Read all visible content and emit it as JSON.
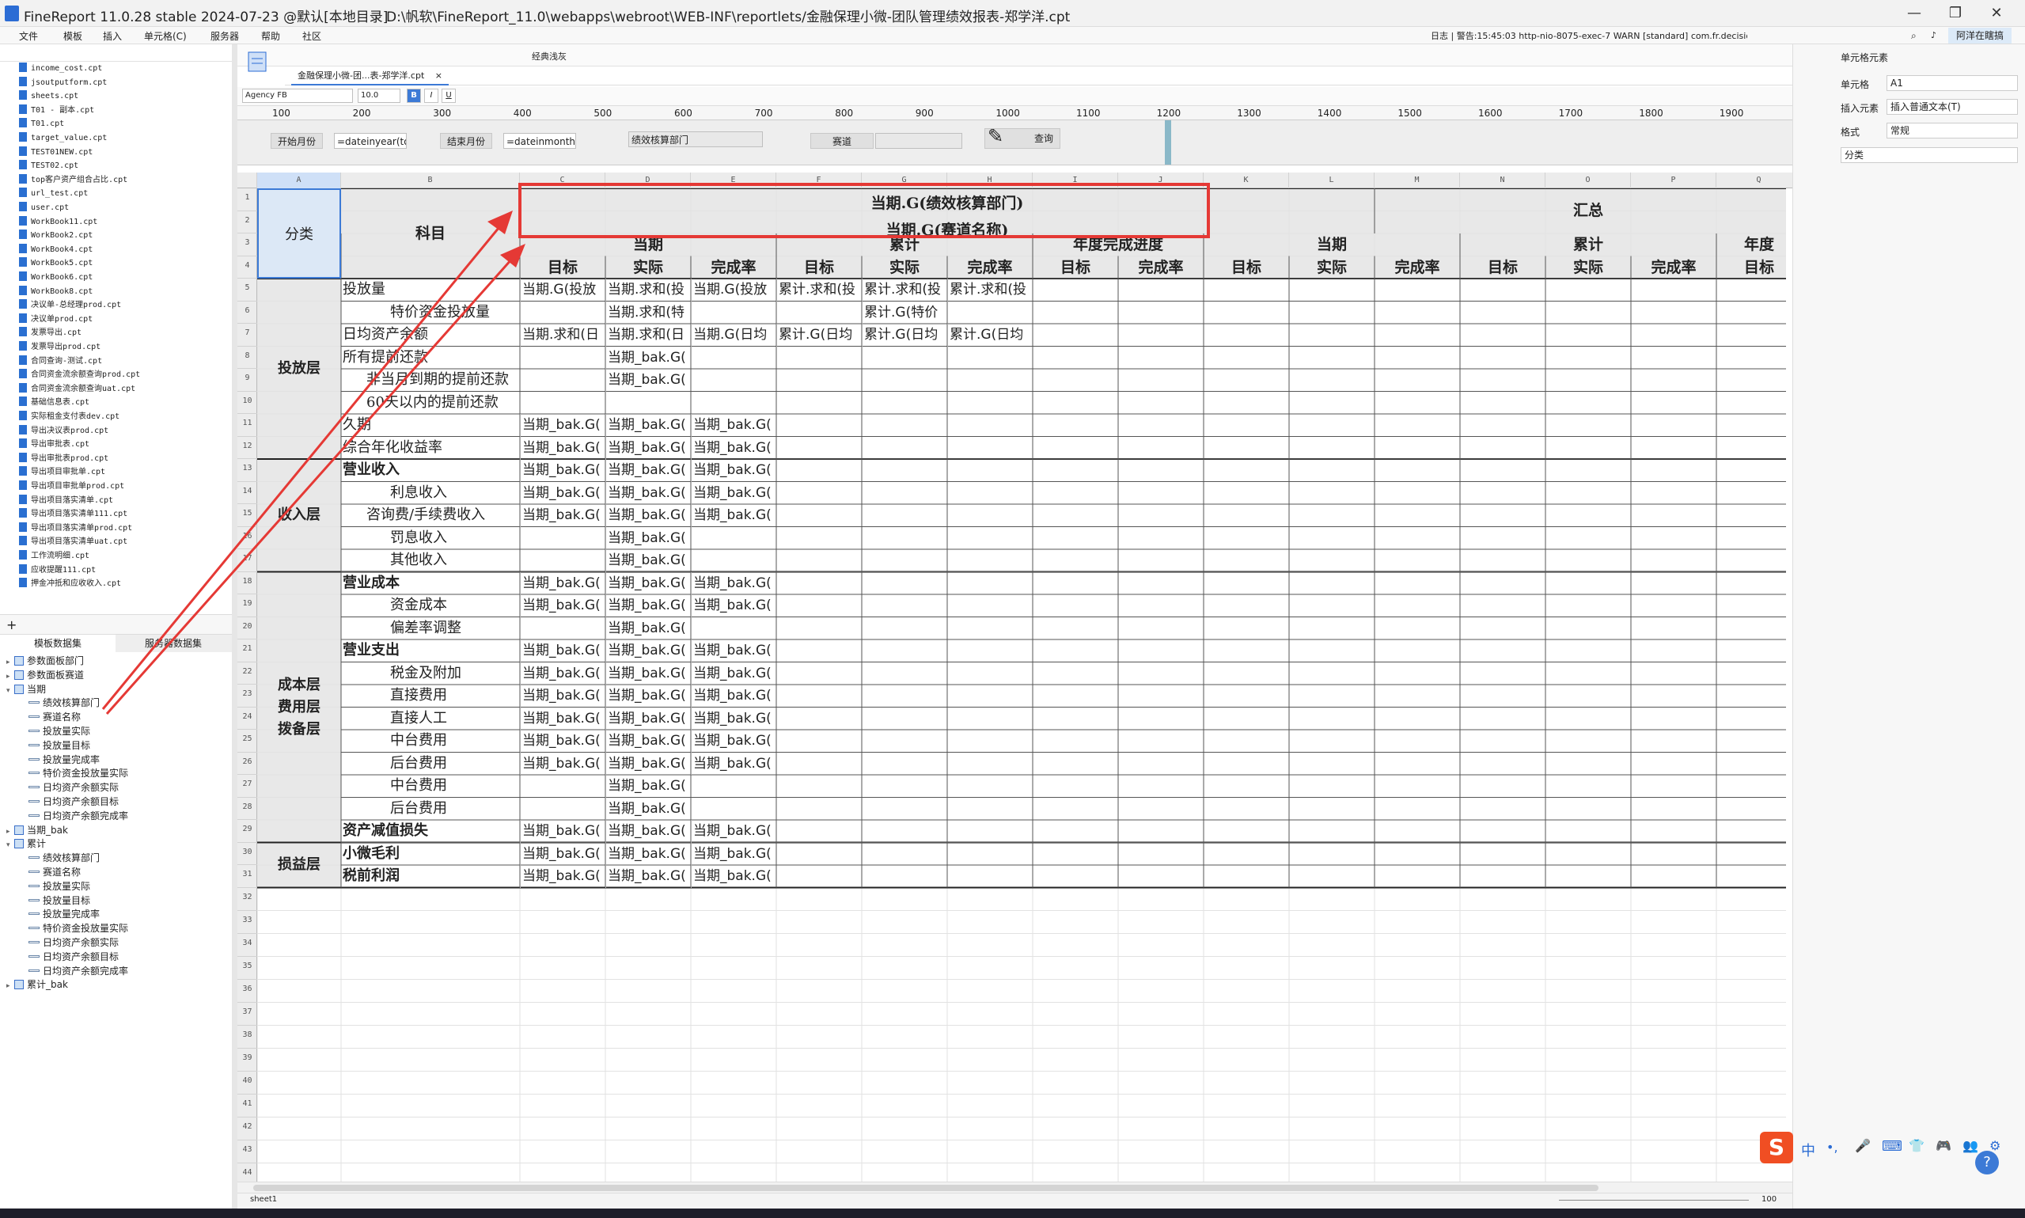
{
  "window": {
    "title": "FineReport 11.0.28 stable 2024-07-23 @默认[本地目录]",
    "path": "D:\\帆软\\FineReport_11.0\\webapps\\webroot\\WEB-INF\\reportlets/金融保理小微-团队管理绩效报表-郑学洋.cpt",
    "min": "—",
    "max": "❐",
    "close": "✕"
  },
  "menu": [
    "文件",
    "模板",
    "插入",
    "单元格(C)",
    "服务器",
    "帮助",
    "社区"
  ],
  "log": "日志 | 警告:15:45:03 http-nio-8075-exec-7 WARN [standard] com.fr.decision.webservice.exception.lo...",
  "user": "阿洋在瞎搞",
  "files": [
    "income_cost.cpt",
    "jsoutputform.cpt",
    "sheets.cpt",
    "T01 - 副本.cpt",
    "T01.cpt",
    "target_value.cpt",
    "TEST01NEW.cpt",
    "TEST02.cpt",
    "top客户资产组合占比.cpt",
    "url_test.cpt",
    "user.cpt",
    "WorkBook11.cpt",
    "WorkBook2.cpt",
    "WorkBook4.cpt",
    "WorkBook5.cpt",
    "WorkBook6.cpt",
    "WorkBook8.cpt",
    "决议单-总经理prod.cpt",
    "决议单prod.cpt",
    "发票导出.cpt",
    "发票导出prod.cpt",
    "合同查询-测试.cpt",
    "合同资金流余额查询prod.cpt",
    "合同资金流余额查询uat.cpt",
    "基础信息表.cpt",
    "实际租金支付表dev.cpt",
    "导出决议表prod.cpt",
    "导出审批表.cpt",
    "导出审批表prod.cpt",
    "导出项目审批单.cpt",
    "导出项目审批单prod.cpt",
    "导出项目落实清单.cpt",
    "导出项目落实清单111.cpt",
    "导出项目落实清单prod.cpt",
    "导出项目落实清单uat.cpt",
    "工作流明细.cpt",
    "应收提醒111.cpt",
    "押金冲抵和应收收入.cpt"
  ],
  "left_tabs": [
    "模板数据集",
    "服务器数据集"
  ],
  "ds_tree": [
    {
      "t": "tbl",
      "label": "参数面板部门",
      "lv": 0,
      "arw": "▸"
    },
    {
      "t": "tbl",
      "label": "参数面板赛道",
      "lv": 0,
      "arw": "▸"
    },
    {
      "t": "tbl",
      "label": "当期",
      "lv": 0,
      "arw": "▾"
    },
    {
      "t": "fld",
      "label": "绩效核算部门",
      "lv": 1
    },
    {
      "t": "fld",
      "label": "赛道名称",
      "lv": 1
    },
    {
      "t": "fld",
      "label": "投放量实际",
      "lv": 1
    },
    {
      "t": "fld",
      "label": "投放量目标",
      "lv": 1
    },
    {
      "t": "fld",
      "label": "投放量完成率",
      "lv": 1
    },
    {
      "t": "fld",
      "label": "特价资金投放量实际",
      "lv": 1
    },
    {
      "t": "fld",
      "label": "日均资产余额实际",
      "lv": 1
    },
    {
      "t": "fld",
      "label": "日均资产余额目标",
      "lv": 1
    },
    {
      "t": "fld",
      "label": "日均资产余额完成率",
      "lv": 1
    },
    {
      "t": "tbl",
      "label": "当期_bak",
      "lv": 0,
      "arw": "▸"
    },
    {
      "t": "tbl",
      "label": "累计",
      "lv": 0,
      "arw": "▾"
    },
    {
      "t": "fld",
      "label": "绩效核算部门",
      "lv": 1
    },
    {
      "t": "fld",
      "label": "赛道名称",
      "lv": 1
    },
    {
      "t": "fld",
      "label": "投放量实际",
      "lv": 1
    },
    {
      "t": "fld",
      "label": "投放量目标",
      "lv": 1
    },
    {
      "t": "fld",
      "label": "投放量完成率",
      "lv": 1
    },
    {
      "t": "fld",
      "label": "特价资金投放量实际",
      "lv": 1
    },
    {
      "t": "fld",
      "label": "日均资产余额实际",
      "lv": 1
    },
    {
      "t": "fld",
      "label": "日均资产余额目标",
      "lv": 1
    },
    {
      "t": "fld",
      "label": "日均资产余额完成率",
      "lv": 1
    },
    {
      "t": "tbl",
      "label": "累计_bak",
      "lv": 0,
      "arw": "▸"
    }
  ],
  "tab": "金融保理小微-团...表-郑学洋.cpt",
  "tab_close": "×",
  "toolbar_text": "经典浅灰",
  "font_name": "Agency FB",
  "font_size": "10.0",
  "ruler": [
    "100",
    "200",
    "300",
    "400",
    "500",
    "600",
    "700",
    "800",
    "900",
    "1000",
    "1100",
    "1200",
    "1300",
    "1400",
    "1500",
    "1600",
    "1700",
    "1800",
    "1900"
  ],
  "params": {
    "start_label": "开始月份",
    "start_val": "=dateinyear(tod",
    "end_label": "结束月份",
    "end_val": "=dateinmonth(t",
    "dept": "绩效核算部门",
    "track": "赛道",
    "query": "查询"
  },
  "cols": [
    "A",
    "B",
    "C",
    "D",
    "E",
    "F",
    "G",
    "H",
    "I",
    "J",
    "K",
    "L",
    "M",
    "N",
    "O",
    "P",
    "Q"
  ],
  "rows": [
    "1",
    "2",
    "3",
    "4",
    "5",
    "6",
    "7",
    "8",
    "9",
    "10",
    "11",
    "12",
    "13",
    "14",
    "15",
    "16",
    "17",
    "18",
    "19",
    "20",
    "21",
    "22",
    "23",
    "24",
    "25",
    "26",
    "27",
    "28",
    "29",
    "30",
    "31",
    "32",
    "33",
    "34",
    "35",
    "36",
    "37",
    "38",
    "39",
    "40",
    "41",
    "42",
    "43",
    "44"
  ],
  "report": {
    "r1": "当期.G(绩效核算部门)",
    "r2": "当期.G(赛道名称)",
    "summary": "汇总",
    "cat_head": "分类",
    "subj_head": "科目",
    "g_cur": "当期",
    "g_cum": "累计",
    "g_year": "年度完成进度",
    "g_cur2": "当期",
    "g_cum2": "累计",
    "g_year2": "年度",
    "sub": [
      "目标",
      "实际",
      "完成率",
      "目标",
      "实际",
      "完成率",
      "目标",
      "完成率",
      "目标",
      "实际",
      "完成率",
      "目标",
      "实际",
      "完成率",
      "目标"
    ],
    "cats": [
      "投放层",
      "收入层",
      "成本层\n费用层\n拨备层",
      "损益层"
    ],
    "subjects": [
      "投放量",
      "特价资金投放量",
      "日均资产余额",
      "所有提前还款",
      "非当月到期的提前还款",
      "60天以内的提前还款",
      "久期",
      "综合年化收益率",
      "营业收入",
      "利息收入",
      "咨询费/手续费收入",
      "罚息收入",
      "其他收入",
      "营业成本",
      "资金成本",
      "偏差率调整",
      "营业支出",
      "税金及附加",
      "直接费用",
      "直接人工",
      "中台费用",
      "后台费用",
      "中台费用",
      "后台费用",
      "资产减值损失",
      "小微毛利",
      "税前利润"
    ],
    "cells": [
      [
        "当期.G(投放",
        "当期.求和(投",
        "当期.G(投放",
        "累计.求和(投",
        "累计.求和(投",
        "累计.求和(投"
      ],
      [
        "",
        "当期.求和(特",
        "",
        "",
        "累计.G(特价",
        ""
      ],
      [
        "当期.求和(日",
        "当期.求和(日",
        "当期.G(日均",
        "累计.G(日均",
        "累计.G(日均",
        "累计.G(日均"
      ],
      [
        "",
        "当期_bak.G(",
        "",
        "",
        "",
        ""
      ],
      [
        "",
        "当期_bak.G(",
        "",
        "",
        "",
        ""
      ],
      [
        "",
        "",
        "",
        "",
        "",
        ""
      ],
      [
        "当期_bak.G(",
        "当期_bak.G(",
        "当期_bak.G(",
        "",
        "",
        ""
      ],
      [
        "当期_bak.G(",
        "当期_bak.G(",
        "当期_bak.G(",
        "",
        "",
        ""
      ],
      [
        "当期_bak.G(",
        "当期_bak.G(",
        "当期_bak.G(",
        "",
        "",
        ""
      ],
      [
        "当期_bak.G(",
        "当期_bak.G(",
        "当期_bak.G(",
        "",
        "",
        ""
      ],
      [
        "当期_bak.G(",
        "当期_bak.G(",
        "当期_bak.G(",
        "",
        "",
        ""
      ],
      [
        "",
        "当期_bak.G(",
        "",
        "",
        "",
        ""
      ],
      [
        "",
        "当期_bak.G(",
        "",
        "",
        "",
        ""
      ],
      [
        "当期_bak.G(",
        "当期_bak.G(",
        "当期_bak.G(",
        "",
        "",
        ""
      ],
      [
        "当期_bak.G(",
        "当期_bak.G(",
        "当期_bak.G(",
        "",
        "",
        ""
      ],
      [
        "",
        "当期_bak.G(",
        "",
        "",
        "",
        ""
      ],
      [
        "当期_bak.G(",
        "当期_bak.G(",
        "当期_bak.G(",
        "",
        "",
        ""
      ],
      [
        "当期_bak.G(",
        "当期_bak.G(",
        "当期_bak.G(",
        "",
        "",
        ""
      ],
      [
        "当期_bak.G(",
        "当期_bak.G(",
        "当期_bak.G(",
        "",
        "",
        ""
      ],
      [
        "当期_bak.G(",
        "当期_bak.G(",
        "当期_bak.G(",
        "",
        "",
        ""
      ],
      [
        "当期_bak.G(",
        "当期_bak.G(",
        "当期_bak.G(",
        "",
        "",
        ""
      ],
      [
        "当期_bak.G(",
        "当期_bak.G(",
        "当期_bak.G(",
        "",
        "",
        ""
      ],
      [
        "",
        "当期_bak.G(",
        "",
        "",
        "",
        ""
      ],
      [
        "",
        "当期_bak.G(",
        "",
        "",
        "",
        ""
      ],
      [
        "当期_bak.G(",
        "当期_bak.G(",
        "当期_bak.G(",
        "",
        "",
        ""
      ],
      [
        "当期_bak.G(",
        "当期_bak.G(",
        "当期_bak.G(",
        "",
        "",
        ""
      ],
      [
        "当期_bak.G(",
        "当期_bak.G(",
        "当期_bak.G(",
        "",
        "",
        ""
      ]
    ]
  },
  "sheet": "sheet1",
  "zoom": "100",
  "right": {
    "title": "单元格元素",
    "cell_label": "单元格",
    "cell_val": "A1",
    "insert_label": "插入元素",
    "insert_val": "插入普通文本(T)",
    "format_label": "格式",
    "format_val": "常规",
    "content": "分类"
  },
  "ime": [
    "中",
    "•,",
    "🎤",
    "⌨",
    "👕",
    "🎮",
    "👥",
    "⚙"
  ],
  "help": "?",
  "accent": "#3c7ad6",
  "highlight": "#e53935"
}
